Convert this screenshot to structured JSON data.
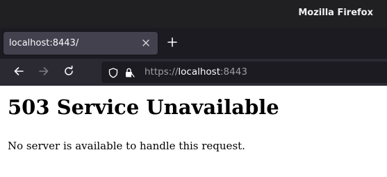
{
  "window": {
    "title": "Mozilla Firefox"
  },
  "tabs": [
    {
      "label": "localhost:8443/",
      "active": true
    }
  ],
  "urlbar": {
    "scheme": "https://",
    "host": "localhost",
    "port": ":8443"
  },
  "page": {
    "heading": "503 Service Unavailable",
    "message": "No server is available to handle this request."
  },
  "colors": {
    "titlebar": "#202023",
    "tabstrip": "#1c1b22",
    "active_tab": "#42414d",
    "navbar": "#2b2a33",
    "urlbar": "#1c1b22",
    "page_bg": "#ffffff"
  },
  "icons": {
    "new_tab": "plus-icon",
    "tab_close": "close-icon",
    "back": "arrow-left-icon",
    "forward": "arrow-right-icon",
    "reload": "reload-icon",
    "tracking_protection": "shield-icon",
    "site_security": "lock-icon"
  }
}
